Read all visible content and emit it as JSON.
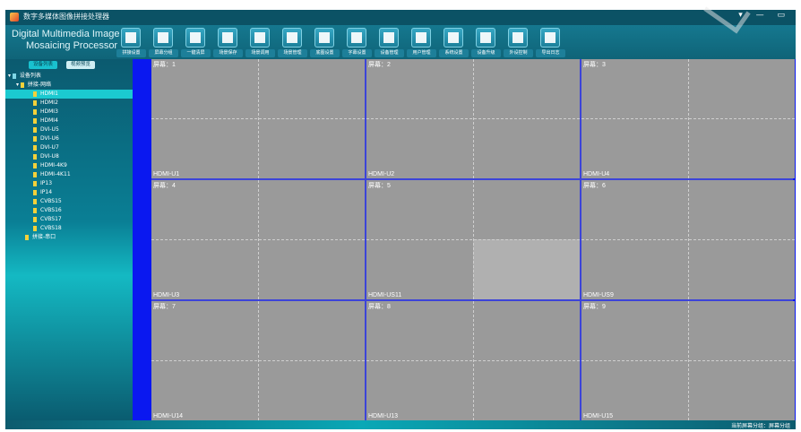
{
  "window": {
    "title": "数字多媒体图像拼接处理器",
    "controls": "▾ — ▭"
  },
  "brand": {
    "line1": "Digital Multimedia Image",
    "line2": "Mosaicing Processor"
  },
  "toolbar": [
    {
      "label": "拼接设置",
      "icon": "layout-icon"
    },
    {
      "label": "屏幕分组",
      "icon": "network-icon"
    },
    {
      "label": "一键清屏",
      "icon": "monitor-icon"
    },
    {
      "label": "场景保存",
      "icon": "copy-icon"
    },
    {
      "label": "场景调用",
      "icon": "grid-icon"
    },
    {
      "label": "场景管理",
      "icon": "grid-gear-icon"
    },
    {
      "label": "底图设置",
      "icon": "image-icon"
    },
    {
      "label": "字幕设置",
      "icon": "document-icon"
    },
    {
      "label": "设备管理",
      "icon": "share-icon"
    },
    {
      "label": "用户管理",
      "icon": "users-icon"
    },
    {
      "label": "系统设置",
      "icon": "gear-icon"
    },
    {
      "label": "设备升级",
      "icon": "upgrade-icon"
    },
    {
      "label": "外设控制",
      "icon": "sliders-icon"
    },
    {
      "label": "导出日志",
      "icon": "log-icon"
    }
  ],
  "sidebar": {
    "tabs": [
      "设备列表",
      "视频预览"
    ],
    "tree_root": "设备列表",
    "network_node": "拼接-网络",
    "serial_node": "拼接-串口",
    "inputs": [
      "HDMI1",
      "HDMI2",
      "HDMI3",
      "HDMI4",
      "DVI-U5",
      "DVI-U6",
      "DVI-U7",
      "DVI-U8",
      "HDMI-4K9",
      "HDMI-4K11",
      "IP13",
      "IP14",
      "CVBS15",
      "CVBS16",
      "CVBS17",
      "CVBS18"
    ],
    "selected": "HDMI1"
  },
  "wall": {
    "screens": [
      {
        "label": "屏幕：1",
        "source": "HDMI-U1"
      },
      {
        "label": "屏幕：2",
        "source": "HDMI-U2"
      },
      {
        "label": "屏幕：3",
        "source": "HDMI-U4"
      },
      {
        "label": "屏幕：4",
        "source": "HDMI-U3"
      },
      {
        "label": "屏幕：5",
        "source": "HDMI-US11"
      },
      {
        "label": "屏幕：6",
        "source": "HDMI-US9"
      },
      {
        "label": "屏幕：7",
        "source": "HDMI-U14"
      },
      {
        "label": "屏幕：8",
        "source": "HDMI-U13"
      },
      {
        "label": "屏幕：9",
        "source": "HDMI-U15"
      }
    ],
    "highlighted_screen": "屏幕：5"
  },
  "status": {
    "text": "当前屏幕分组：屏幕分组"
  },
  "colors": {
    "accent": "#0f6f86",
    "wall_bg": "#0a18f0",
    "screen": "#9a9a9a",
    "selected": "#1bcad0"
  }
}
